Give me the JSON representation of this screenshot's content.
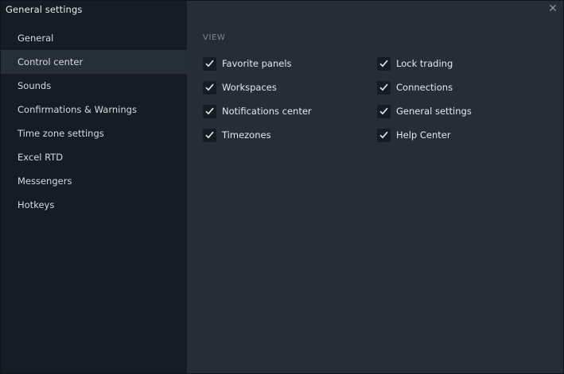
{
  "window": {
    "title": "General settings",
    "close_glyph": "✕"
  },
  "sidebar": {
    "items": [
      {
        "label": "General"
      },
      {
        "label": "Control center",
        "active": true
      },
      {
        "label": "Sounds"
      },
      {
        "label": "Confirmations & Warnings"
      },
      {
        "label": "Time zone settings"
      },
      {
        "label": "Excel RTD"
      },
      {
        "label": "Messengers"
      },
      {
        "label": "Hotkeys"
      }
    ]
  },
  "view": {
    "section_title": "VIEW",
    "left_options": [
      {
        "label": "Favorite panels",
        "checked": true
      },
      {
        "label": "Workspaces",
        "checked": true
      },
      {
        "label": "Notifications center",
        "checked": true
      },
      {
        "label": "Timezones",
        "checked": true
      }
    ],
    "right_options": [
      {
        "label": "Lock trading",
        "checked": true
      },
      {
        "label": "Connections",
        "checked": true
      },
      {
        "label": "General settings",
        "checked": true
      },
      {
        "label": "Help Center",
        "checked": true
      }
    ]
  },
  "colors": {
    "sidebar_bg": "#151c24",
    "content_bg": "#262d37",
    "checkbox_bg": "#161c23",
    "text": "#e4e8ec"
  },
  "icons": {
    "checkbox": "check-icon",
    "close": "close-icon"
  }
}
